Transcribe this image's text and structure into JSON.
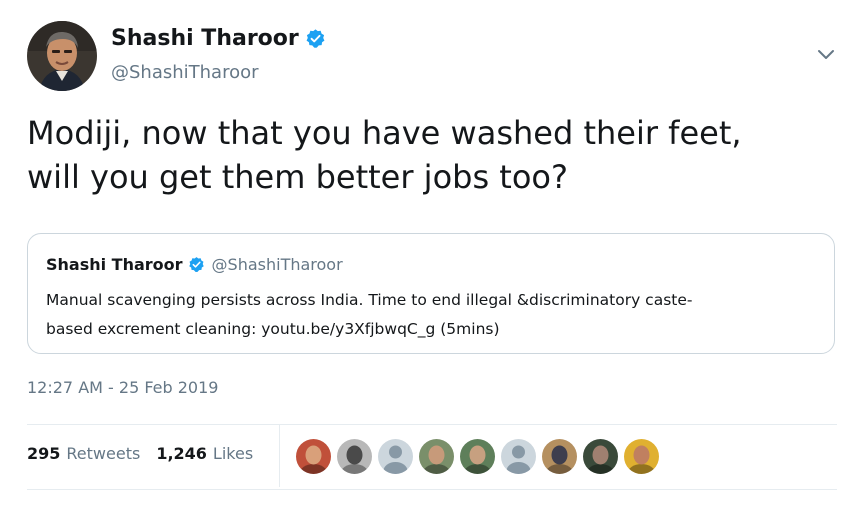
{
  "author": {
    "name": "Shashi Tharoor",
    "handle": "@ShashiTharoor"
  },
  "tweet": {
    "lines": [
      "Modiji, now that you have washed their feet,",
      "will you get them better jobs too?"
    ]
  },
  "quoted_tweet": {
    "name": "Shashi Tharoor",
    "handle": "@ShashiTharoor",
    "lines": [
      "Manual scavenging persists across India. Time to end illegal &discriminatory caste-",
      "based excrement cleaning:  youtu.be/y3XfjbwqC_g (5mins)"
    ]
  },
  "timestamp": "12:27 AM - 25 Feb 2019",
  "stats": {
    "retweets_count": "295",
    "retweets_label": "Retweets",
    "likes_count": "1,246",
    "likes_label": "Likes"
  },
  "likers": [
    {
      "kind": "photo",
      "bg": "#c0503a",
      "face": "#d9a07a"
    },
    {
      "kind": "photo",
      "bg": "#b8b8b8",
      "face": "#4a4a4a"
    },
    {
      "kind": "default",
      "bg": "#ccd6dd",
      "face": "#8899a6"
    },
    {
      "kind": "photo",
      "bg": "#7a8f6a",
      "face": "#c79a7a"
    },
    {
      "kind": "photo",
      "bg": "#5e7f5a",
      "face": "#c7a080"
    },
    {
      "kind": "default",
      "bg": "#ccd6dd",
      "face": "#8899a6"
    },
    {
      "kind": "photo",
      "bg": "#b59060",
      "face": "#3e3e4e"
    },
    {
      "kind": "photo",
      "bg": "#3a4a3a",
      "face": "#a08070"
    },
    {
      "kind": "photo",
      "bg": "#e0b030",
      "face": "#c08060"
    }
  ],
  "colors": {
    "verified": "#1da1f2",
    "secondary_text": "#657786",
    "border": "#ccd6dd"
  },
  "icons": {
    "verified": "verified-badge-icon",
    "caret": "chevron-down-icon"
  }
}
